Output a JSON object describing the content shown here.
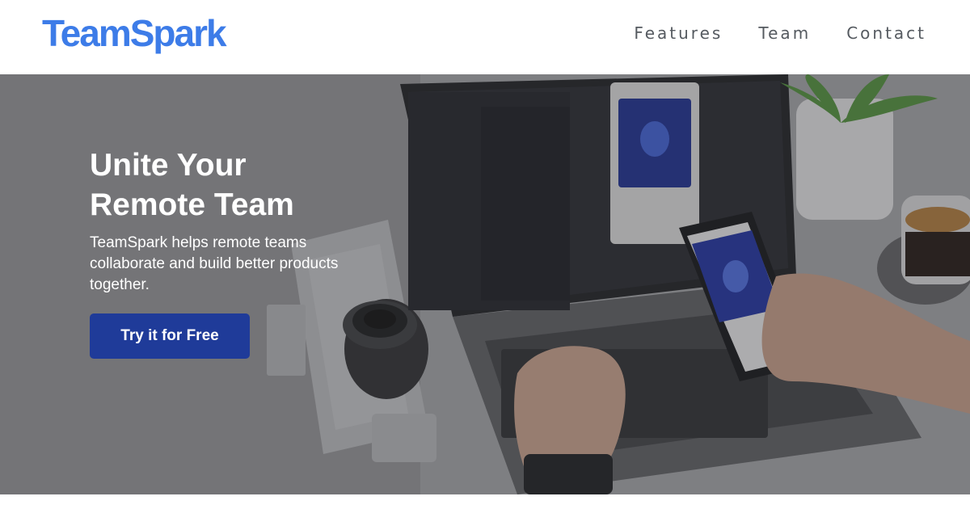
{
  "brand": {
    "name": "TeamSpark",
    "color": "#3d7ce8"
  },
  "nav": {
    "items": [
      {
        "label": "Features"
      },
      {
        "label": "Team"
      },
      {
        "label": "Contact"
      }
    ]
  },
  "hero": {
    "title_line1": "Unite Your",
    "title_line2": "Remote Team",
    "description": "TeamSpark helps remote teams collaborate and build better products together.",
    "cta_label": "Try it for Free",
    "cta_color": "#1f3b99",
    "image_subject": "laptop-and-phone-desk-photo"
  }
}
